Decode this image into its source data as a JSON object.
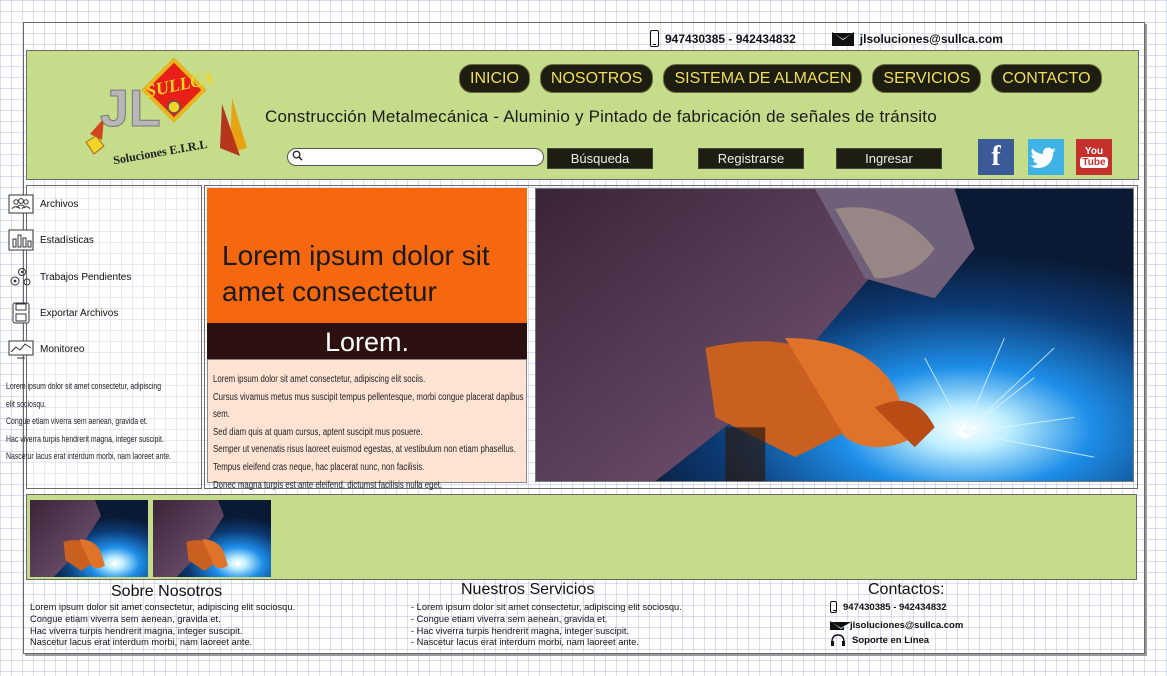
{
  "topbar": {
    "phones": "947430385 - 942434832",
    "email": "jlsoluciones@sullca.com"
  },
  "logo": {
    "text": "SULLCA",
    "initials": "JL",
    "subtitle": "Soluciones E.I.R.L"
  },
  "nav": [
    "INICIO",
    "NOSOTROS",
    "SISTEMA DE ALMACEN",
    "SERVICIOS",
    "CONTACTO"
  ],
  "tagline": "Construcción Metalmecánica - Aluminio y Pintado de fabricación de señales de tránsito",
  "search": {
    "placeholder": "",
    "button": "Búsqueda"
  },
  "auth": {
    "register": "Registrarse",
    "login": "Ingresar"
  },
  "social": {
    "facebook": "f",
    "youtube_top": "You",
    "youtube_bottom": "Tube"
  },
  "sidebar": {
    "items": [
      {
        "label": "Archivos",
        "icon": "users-icon"
      },
      {
        "label": "Estadísticas",
        "icon": "bar-chart-icon"
      },
      {
        "label": "Trabajos Pendientes",
        "icon": "gears-icon"
      },
      {
        "label": "Exportar Archivos",
        "icon": "floppy-icon"
      },
      {
        "label": "Monitoreo",
        "icon": "monitor-icon"
      }
    ],
    "text": [
      "Lorem ipsum dolor sit amet consectetur, adipiscing elit sociosqu.",
      "Congue etiam viverra sem aenean, gravida et.",
      "Hac viverra turpis hendrerit magna, integer suscipit.",
      "Nascetur lacus erat interdum morbi, nam laoreet ante."
    ]
  },
  "feature": {
    "title": "Lorem ipsum dolor sit amet consectetur",
    "subtitle": "Lorem.",
    "body": [
      "Lorem ipsum dolor sit amet consectetur, adipiscing elit sociis.",
      "Cursus vivamus metus mus suscipit tempus pellentesque, morbi congue placerat dapibus sem.",
      "Sed diam quis at quam cursus, aptent suscipit mus posuere.",
      "Semper ut venenatis risus laoreet euismod egestas, at vestibulum non etiam phasellus.",
      "Tempus eleifend cras neque, hac placerat nunc, non facilisis.",
      "Donec magna turpis est ante eleifend, dictumst facilisis nulla eget."
    ]
  },
  "footer": {
    "about": {
      "title": "Sobre Nosotros",
      "lines": [
        "Lorem ipsum dolor sit amet consectetur, adipiscing elit sociosqu.",
        "Congue etiam viverra sem aenean, gravida et.",
        "Hac viverra turpis hendrerit magna, integer suscipit.",
        "Nascetur lacus erat interdum morbi, nam laoreet ante."
      ]
    },
    "services": {
      "title": "Nuestros Servicios",
      "lines": [
        "- Lorem ipsum dolor sit amet consectetur, adipiscing elit sociosqu.",
        "- Congue etiam viverra sem aenean, gravida et.",
        "- Hac viverra turpis hendrerit magna, integer suscipit.",
        "- Nascetur lacus erat interdum morbi, nam laoreet ante."
      ]
    },
    "contacts": {
      "title": "Contactos:",
      "phone": "947430385 - 942434832",
      "email": "jlsoluciones@sullca.com",
      "support": "Soporte en Línea"
    }
  }
}
